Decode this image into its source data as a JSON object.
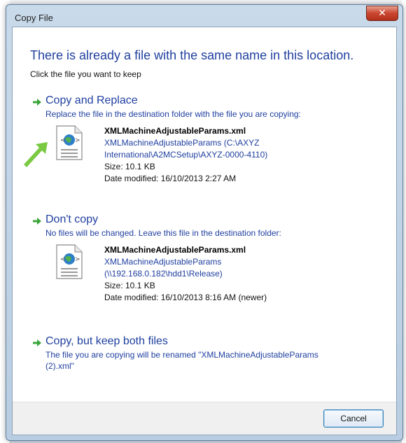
{
  "window": {
    "title": "Copy File",
    "close_glyph": "✕"
  },
  "header": {
    "title": "There is already a file with the same name in this location.",
    "subtitle": "Click the file you want to keep"
  },
  "options": [
    {
      "title": "Copy and Replace",
      "description": "Replace the file in the destination folder with the file you are copying:",
      "file": {
        "name": "XMLMachineAdjustableParams.xml",
        "path_line1": "XMLMachineAdjustableParams (C:\\AXYZ",
        "path_line2": "International\\A2MCSetup\\AXYZ-0000-4110)",
        "size": "Size: 10.1 KB",
        "date": "Date modified: 16/10/2013 2:27 AM"
      }
    },
    {
      "title": "Don't copy",
      "description": "No files will be changed. Leave this file in the destination folder:",
      "file": {
        "name": "XMLMachineAdjustableParams.xml",
        "path_line1": "XMLMachineAdjustableParams",
        "path_line2": "(\\\\192.168.0.182\\hdd1\\Release)",
        "size": "Size: 10.1 KB",
        "date": "Date modified: 16/10/2013 8:16 AM (newer)"
      }
    },
    {
      "title": "Copy, but keep both files",
      "description_line1": "The file you are copying will be renamed \"XMLMachineAdjustableParams",
      "description_line2": "(2).xml\""
    }
  ],
  "footer": {
    "cancel_label": "Cancel"
  },
  "icons": {
    "option_arrow": "green-arrow-icon",
    "file": "xml-file-icon",
    "callout": "callout-arrow-icon"
  },
  "colors": {
    "link_blue": "#1f3f9f",
    "arrow_green": "#3aa53a",
    "callout_green": "#7ac943"
  }
}
